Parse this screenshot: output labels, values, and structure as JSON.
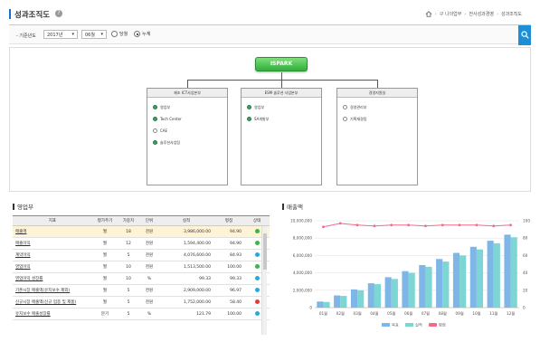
{
  "header": {
    "title": "성과조직도",
    "help": "?",
    "breadcrumbs": [
      "구 나의업무",
      "전사성과경영",
      "성과조직도"
    ]
  },
  "filter": {
    "label": "- 기준년도",
    "year": "2017년",
    "month": "06월",
    "radio_current": "당월",
    "radio_cumulative": "누계",
    "selected": "누계"
  },
  "org": {
    "root": "ISPARK",
    "divisions": [
      {
        "name": "제조 ICT사업본부",
        "items": [
          {
            "label": "영업부",
            "green": true
          },
          {
            "label": "Tech Center",
            "green": true
          },
          {
            "label": "CAE",
            "green": false
          },
          {
            "label": "솔루션사업팀",
            "green": true
          }
        ]
      },
      {
        "name": "ESM 솔루션 사업본부",
        "items": [
          {
            "label": "영업부",
            "green": true
          },
          {
            "label": "SA개발부",
            "green": true
          }
        ]
      },
      {
        "name": "경영지원실",
        "items": [
          {
            "label": "경영관리부",
            "green": false
          },
          {
            "label": "기획재경팀",
            "green": false
          }
        ]
      }
    ]
  },
  "table_section": {
    "title": "영업부",
    "columns": [
      "지표",
      "평가주기",
      "가중치",
      "단위",
      "실적",
      "평점",
      "상태"
    ],
    "rows": [
      [
        "매출액",
        "월",
        "18",
        "천원",
        "3,986,000.00",
        "94.90"
      ],
      [
        "매출이익",
        "월",
        "12",
        "천원",
        "1,594,400.00",
        "94.90"
      ],
      [
        "계약이익",
        "월",
        "5",
        "천원",
        "4,076,600.00",
        "84.93"
      ],
      [
        "영업이익",
        "월",
        "10",
        "천원",
        "1,513,500.00",
        "100.00"
      ],
      [
        "영업이익 성장률",
        "월",
        "10",
        "%",
        "99.33",
        "99.33"
      ],
      [
        "기존시장 매출액(유지보수 제외)",
        "월",
        "5",
        "천원",
        "2,909,000.00",
        "96.97"
      ],
      [
        "신규시장 매출액(신규 업종 및 제품)",
        "월",
        "5",
        "천원",
        "1,752,000.00",
        "58.40"
      ],
      [
        "유지보수 매출성장률",
        "분기",
        "5",
        "%",
        "121.79",
        "100.00"
      ]
    ],
    "status_colors": [
      "#3cb44b",
      "#3cb44b",
      "#29a8e0",
      "#3cb44b",
      "#29a8e0",
      "#29a8e0",
      "#e53935",
      "#29a8e0"
    ]
  },
  "chart_section": {
    "title": "매출액"
  },
  "chart_data": {
    "type": "bar",
    "title": "",
    "categories": [
      "01월",
      "02월",
      "03월",
      "04월",
      "05월",
      "06월",
      "07월",
      "08월",
      "09월",
      "10월",
      "11월",
      "12월"
    ],
    "y_left_ticks": [
      "10,000,000",
      "8,000,000",
      "6,000,000",
      "4,000,000",
      "2,000,000",
      "0"
    ],
    "y_right_ticks": [
      "100",
      "80",
      "60",
      "40",
      "20",
      "0"
    ],
    "ylim_left": [
      0,
      10000000
    ],
    "ylim_right": [
      0,
      100
    ],
    "series": [
      {
        "name": "목표",
        "kind": "bar",
        "color": "#7fb6e8",
        "values": [
          700000,
          1400000,
          2100000,
          2800000,
          3500000,
          4200000,
          4900000,
          5600000,
          6300000,
          7000000,
          7700000,
          8400000
        ]
      },
      {
        "name": "실적",
        "kind": "bar",
        "color": "#7dd6d3",
        "values": [
          650000,
          1350000,
          2000000,
          2700000,
          3300000,
          4000000,
          4700000,
          5300000,
          6000000,
          6700000,
          7400000,
          8100000
        ]
      },
      {
        "name": "평점",
        "kind": "line",
        "color": "#f06a8a",
        "values": [
          93,
          97,
          95,
          94,
          95,
          95,
          94,
          95,
          95,
          95,
          94,
          95
        ]
      }
    ],
    "legend_position": "bottom"
  }
}
